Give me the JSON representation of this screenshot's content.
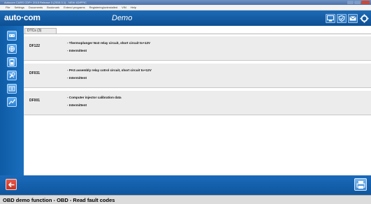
{
  "window": {
    "title": "Autocom CARS CDP+ 2015 Release 3 (2015.3.1) - NEW 4DIPPIC"
  },
  "menu": {
    "items": [
      "File",
      "Settings",
      "Documents",
      "Bookmark",
      "Extend programs",
      "Registering/uninstalled",
      "VIN",
      "Help"
    ]
  },
  "header": {
    "logo": "auto·com",
    "title": "Demo",
    "icons": [
      "car-display-icon",
      "shield-icon",
      "mail-icon",
      "gear-icon"
    ]
  },
  "sidebar": {
    "buttons": [
      "obd-icon",
      "expand-icon",
      "battery-icon",
      "wrench-icon",
      "settings-panel-icon",
      "route-icon"
    ]
  },
  "tabs": [
    {
      "label": "DTCs (3)"
    }
  ],
  "dtcs": [
    {
      "code": "DF122",
      "description": "- Thermoplunger No3 relay circuit, short circuit to+12V",
      "status": "- Intermittent"
    },
    {
      "code": "DF031",
      "description": "- PAS assembly relay cotrol circuit, short circuit to+12V",
      "status": "- Intermittent"
    },
    {
      "code": "DF001",
      "description": "- Computer injector calibration data",
      "status": "- Intermittent"
    }
  ],
  "status_bar": {
    "text": "OBD demo function - OBD - Read fault codes"
  },
  "colors": {
    "brand_blue": "#0d4f92",
    "row_bg": "#ececec",
    "back_red": "#c23325"
  }
}
